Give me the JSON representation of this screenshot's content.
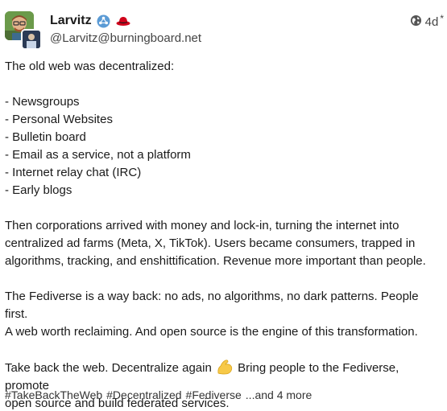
{
  "author": {
    "display_name": "Larvitz",
    "handle": "@Larvitz@burningboard.net",
    "badges": [
      "fediverse-logo-icon",
      "red-hat-icon"
    ]
  },
  "meta": {
    "visibility_icon": "globe-icon",
    "time": "4d",
    "edited_mark": "*"
  },
  "content": {
    "intro": "The old web was decentralized:",
    "list": [
      "- Newsgroups",
      "- Personal Websites",
      "- Bulletin board",
      "- Email as a service, not a platform",
      "- Internet relay chat (IRC)",
      "- Early blogs"
    ],
    "para1_lines": [
      "Then corporations arrived with money and lock-in, turning the internet into",
      "centralized ad farms (Meta, X, TikTok). Users became consumers, trapped in",
      "algorithms, tracking, and enshittification. Revenue more important than people."
    ],
    "para2_lines": [
      "The Fediverse is a way back: no ads, no algorithms, no dark patterns. People first.",
      "A web worth reclaiming. And open source is the engine of this transformation."
    ],
    "para3_line1_before": "Take back the web. Decentralize again",
    "para3_line1_after": "Bring people to the Fediverse, promote",
    "para3_line2": "open source and build federated services."
  },
  "hashtags": [
    "#TakeBackTheWeb",
    "#Decentralized",
    "#Fediverse"
  ],
  "more_tags": "...and 4 more",
  "colors": {
    "fediverse_blue": "#5b9bd5",
    "red_hat": "#d0021b",
    "flex_yellow": "#f7c948"
  }
}
